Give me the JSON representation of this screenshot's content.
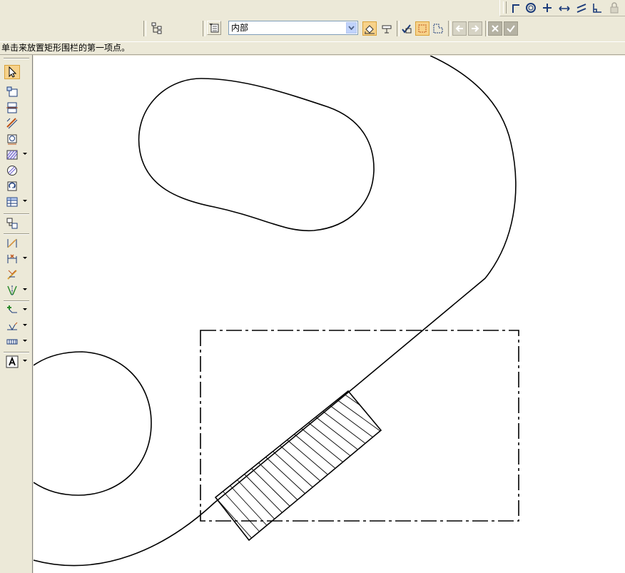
{
  "toolbar": {
    "hatch_style_value": "内部"
  },
  "prompt": {
    "text": "单击来放置矩形围栏的第一项点。"
  },
  "icons": {
    "snap_bar": [
      "corner-snap-icon",
      "circle-snap-icon",
      "intersection-snap-icon",
      "horizontal-snap-icon",
      "parallel-snap-icon",
      "perpendicular-snap-icon",
      "lock-icon"
    ],
    "toolbox": [
      "select-arrow-icon",
      "projection-view-icon",
      "section-view-icon",
      "break-view-icon",
      "detail-view-icon",
      "hatch-icon",
      "circle-hatch-icon",
      "rotate-view-icon",
      "view-table-icon",
      "view-link-icon",
      "dimension-icon",
      "point-dimension-icon",
      "dimension-style-icon",
      "centerline-icon",
      "leader-icon",
      "weld-symbol-icon",
      "table-icon",
      "text-icon"
    ]
  },
  "colors": {
    "chrome": "#ece9d8",
    "canvas": "#ffffff",
    "accent_button": "#f7d28a",
    "stroke": "#000000"
  }
}
